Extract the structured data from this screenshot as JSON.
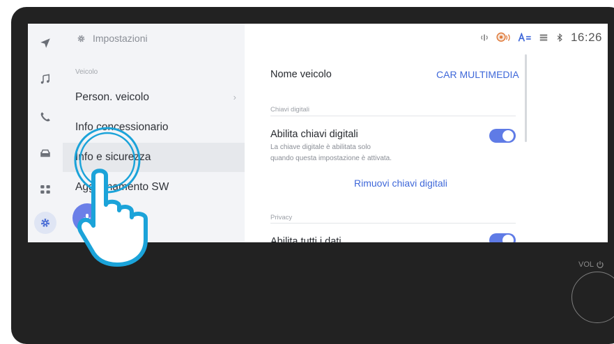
{
  "settings_header": {
    "title": "Impostazioni"
  },
  "menu": {
    "section_label": "Veicolo",
    "items": [
      {
        "label": "Person. veicolo",
        "chevron": "›"
      },
      {
        "label": "Info concessionario"
      },
      {
        "label": "Info e sicurezza"
      },
      {
        "label": "Aggiornamento SW"
      }
    ]
  },
  "status": {
    "time": "16:26",
    "icons": [
      "signal-icon",
      "voice-assistant-icon",
      "text-size-icon",
      "data-icon",
      "bluetooth-icon"
    ]
  },
  "content": {
    "vehicle_name_label": "Nome veicolo",
    "vehicle_name_value": "CAR MULTIMEDIA",
    "digital_keys_section": "Chiavi digitali",
    "enable_keys_label": "Abilita chiavi digitali",
    "enable_keys_desc_line1": "La chiave digitale è abilitata solo",
    "enable_keys_desc_line2": "quando questa impostazione è attivata.",
    "enable_keys_on": true,
    "remove_keys_label": "Rimuovi chiavi digitali",
    "privacy_section": "Privacy",
    "enable_all_data_label": "Abilita tutti i dati",
    "enable_all_data_on": true
  },
  "hardware": {
    "vol_label": "VOL"
  },
  "colors": {
    "accent": "#5f7be6",
    "link": "#3f68d9",
    "bezel": "#222222",
    "touch_overlay": "#1ba3d9"
  }
}
